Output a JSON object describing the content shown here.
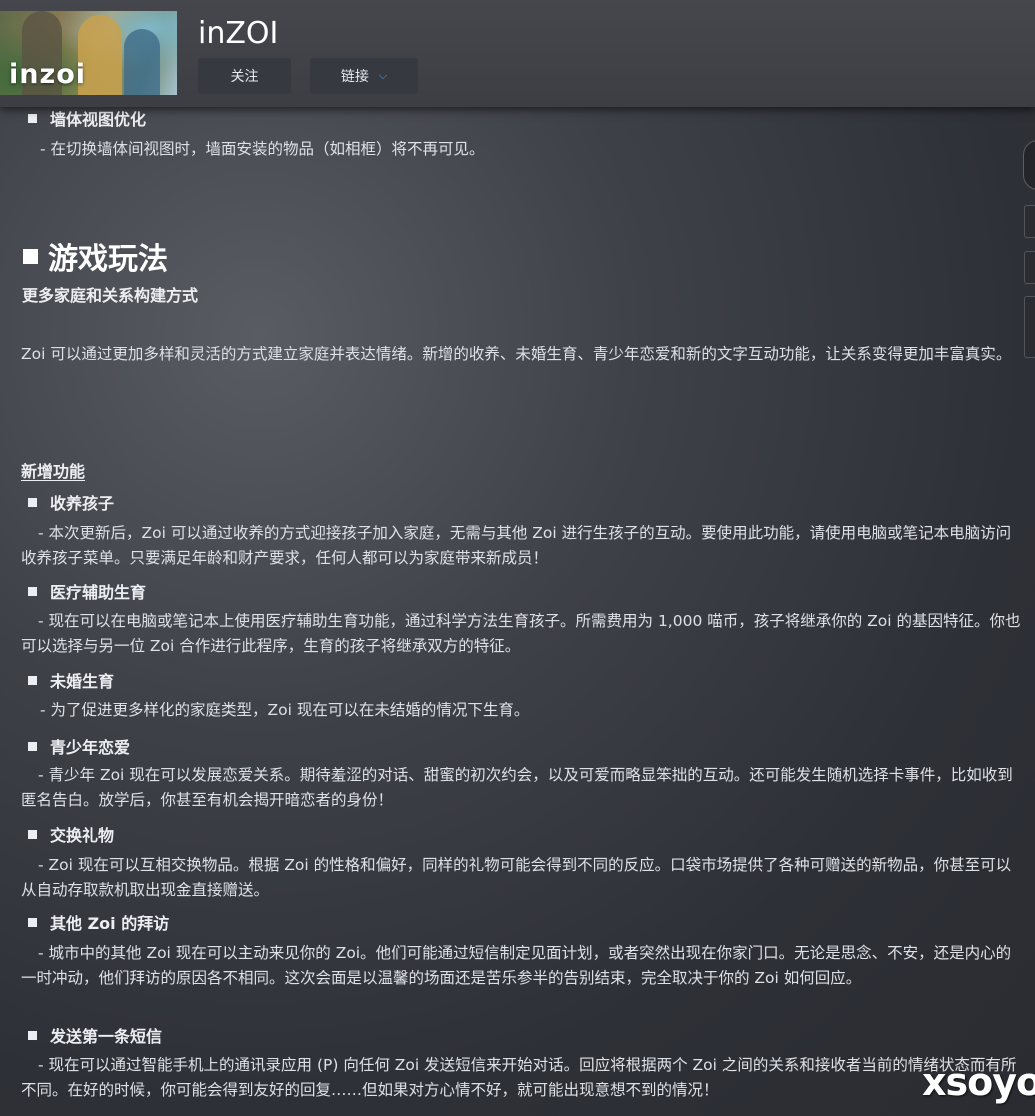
{
  "header": {
    "title": "inZOI",
    "capsule_logo": "inzoi",
    "follow_label": "关注",
    "links_label": "链接",
    "links_chevron": "chevron-down"
  },
  "top_section": {
    "heading": "墙体视图优化",
    "text": "- 在切换墙体间视图时，墙面安装的物品（如相框）将不再可见。"
  },
  "gameplay": {
    "title": "游戏玩法",
    "subtitle": "更多家庭和关系构建方式",
    "intro": "Zoi 可以通过更加多样和灵活的方式建立家庭并表达情绪。新增的收养、未婚生育、青少年恋爱和新的文字互动功能，让关系变得更加丰富真实。",
    "new_features_label": "新增功能",
    "features": [
      {
        "title": "收养孩子",
        "text": "- 本次更新后，Zoi 可以通过收养的方式迎接孩子加入家庭，无需与其他 Zoi 进行生孩子的互动。要使用此功能，请使用电脑或笔记本电脑访问收养孩子菜单。只要满足年龄和财产要求，任何人都可以为家庭带来新成员！"
      },
      {
        "title": "医疗辅助生育",
        "text": "- 现在可以在电脑或笔记本上使用医疗辅助生育功能，通过科学方法生育孩子。所需费用为 1,000 喵币，孩子将继承你的 Zoi 的基因特征。你也可以选择与另一位 Zoi 合作进行此程序，生育的孩子将继承双方的特征。"
      },
      {
        "title": "未婚生育",
        "text": "- 为了促进更多样化的家庭类型，Zoi 现在可以在未结婚的情况下生育。"
      },
      {
        "title": "青少年恋爱",
        "text": "- 青少年 Zoi 现在可以发展恋爱关系。期待羞涩的对话、甜蜜的初次约会，以及可爱而略显笨拙的互动。还可能发生随机选择卡事件，比如收到匿名告白。放学后，你甚至有机会揭开暗恋者的身份！"
      },
      {
        "title": "交换礼物",
        "text": "- Zoi 现在可以互相交换物品。根据 Zoi 的性格和偏好，同样的礼物可能会得到不同的反应。口袋市场提供了各种可赠送的新物品，你甚至可以从自动存取款机取出现金直接赠送。"
      },
      {
        "title": "其他 Zoi 的拜访",
        "text": "- 城市中的其他 Zoi 现在可以主动来见你的 Zoi。他们可能通过短信制定见面计划，或者突然出现在你家门口。无论是思念、不安，还是内心的一时冲动，他们拜访的原因各不相同。这次会面是以温馨的场面还是苦乐参半的告别结束，完全取决于你的 Zoi 如何回应。"
      },
      {
        "title": "发送第一条短信",
        "text": "- 现在可以通过智能手机上的通讯录应用 (P) 向任何 Zoi 发送短信来开始对话。回应将根据两个 Zoi 之间的关系和接收者当前的情绪状态而有所不同。在好的时候，你可能会得到友好的回复……但如果对方心情不好，就可能出现意想不到的情况！"
      }
    ]
  },
  "watermark": "xsoyo"
}
